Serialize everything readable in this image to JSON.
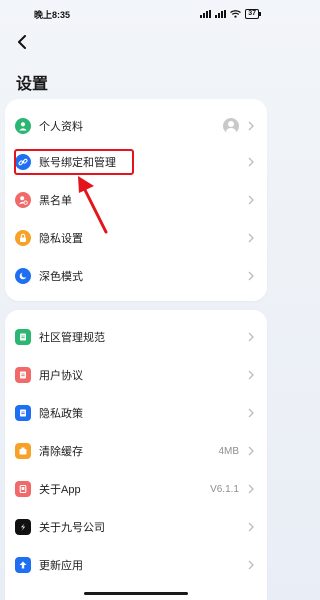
{
  "status_bar": {
    "time": "晚上8:35",
    "battery": "37"
  },
  "page": {
    "title": "设置"
  },
  "section1": [
    {
      "label": "个人资料",
      "icon": "user-icon",
      "color": "#2bb673",
      "has_avatar": true
    },
    {
      "label": "账号绑定和管理",
      "icon": "link-icon",
      "color": "#1e6ff2"
    },
    {
      "label": "黑名单",
      "icon": "blocked-user-icon",
      "color": "#f06a6a"
    },
    {
      "label": "隐私设置",
      "icon": "lock-icon",
      "color": "#f7a227"
    },
    {
      "label": "深色模式",
      "icon": "moon-icon",
      "color": "#1e6ff2"
    }
  ],
  "section2": [
    {
      "label": "社区管理规范",
      "icon": "document-icon",
      "color": "#2bb673"
    },
    {
      "label": "用户协议",
      "icon": "document-icon",
      "color": "#f06a6a"
    },
    {
      "label": "隐私政策",
      "icon": "document-icon",
      "color": "#1e6ff2"
    },
    {
      "label": "清除缓存",
      "icon": "cache-icon",
      "color": "#f7a227",
      "value": "4MB"
    },
    {
      "label": "关于App",
      "icon": "app-icon",
      "color": "#f06a6a",
      "value": "V6.1.1"
    },
    {
      "label": "关于九号公司",
      "icon": "brand-icon",
      "color": "#111111"
    },
    {
      "label": "更新应用",
      "icon": "update-icon",
      "color": "#1e6ff2"
    }
  ],
  "annotation": {
    "highlight_color": "#e4141c"
  }
}
